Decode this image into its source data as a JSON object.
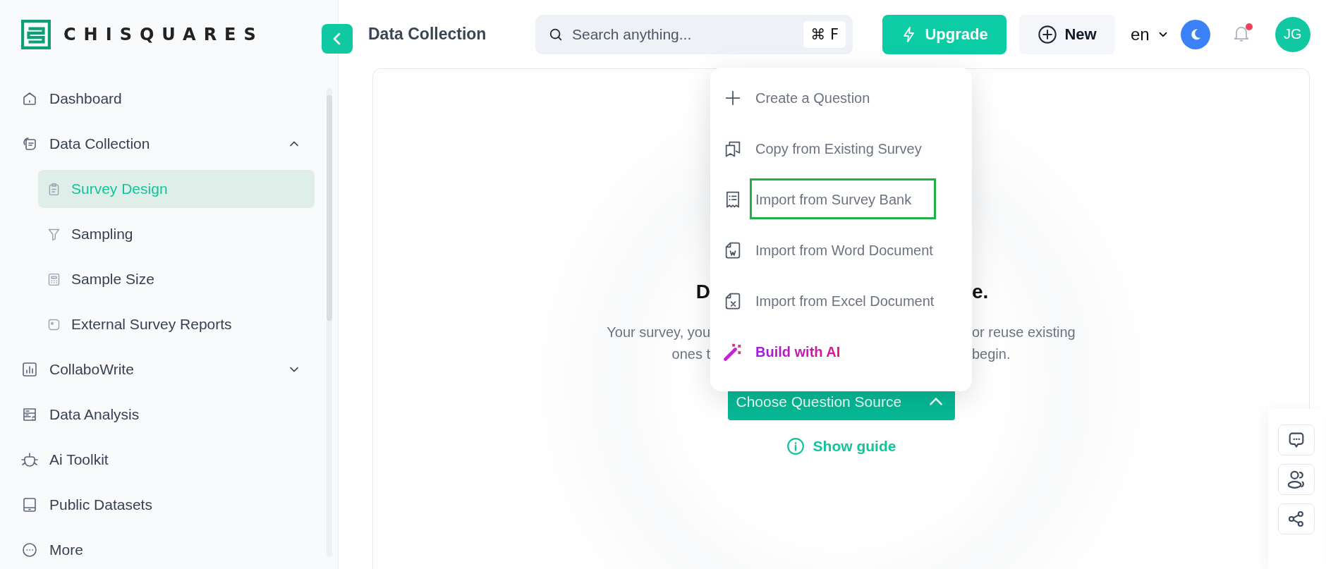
{
  "logo": {
    "text": "CHISQUARES"
  },
  "header": {
    "title": "Data Collection",
    "search": {
      "placeholder": "Search anything...",
      "shortcut": "⌘ F"
    },
    "upgrade": "Upgrade",
    "new": "New",
    "language": "en",
    "notification_unread": true,
    "avatar": "JG"
  },
  "sidebar": {
    "items": [
      {
        "label": "Dashboard",
        "selected": false
      },
      {
        "label": "Data Collection",
        "selected": false,
        "expanded": true,
        "children": [
          {
            "label": "Survey Design",
            "selected": true
          },
          {
            "label": "Sampling",
            "selected": false
          },
          {
            "label": "Sample Size",
            "selected": false
          },
          {
            "label": "External Survey Reports",
            "selected": false
          }
        ]
      },
      {
        "label": "CollaboWrite",
        "selected": false,
        "expanded": false
      },
      {
        "label": "Data Analysis",
        "selected": false
      },
      {
        "label": "Ai Toolkit",
        "selected": false
      },
      {
        "label": "Public Datasets",
        "selected": false
      },
      {
        "label": "More",
        "selected": false
      }
    ]
  },
  "content": {
    "heading_parts": [
      "D",
      "e."
    ],
    "paragraph_lines": [
      [
        "Your survey, you",
        "or reuse existing"
      ],
      [
        "ones t",
        "begin."
      ]
    ],
    "source_button": {
      "label": "Choose Question Source",
      "expanded": true
    },
    "guide_link": "Show guide"
  },
  "menu": {
    "items": [
      {
        "label": "Create a Question",
        "kind": "plain",
        "highlighted": false
      },
      {
        "label": "Copy from Existing Survey",
        "kind": "plain",
        "highlighted": false
      },
      {
        "label": "Import from Survey Bank",
        "kind": "plain",
        "highlighted": true
      },
      {
        "label": "Import from Word Document",
        "kind": "plain",
        "highlighted": false
      },
      {
        "label": "Import from Excel Document",
        "kind": "plain",
        "highlighted": false
      },
      {
        "label": "Build with AI",
        "kind": "ai",
        "highlighted": false
      }
    ]
  }
}
